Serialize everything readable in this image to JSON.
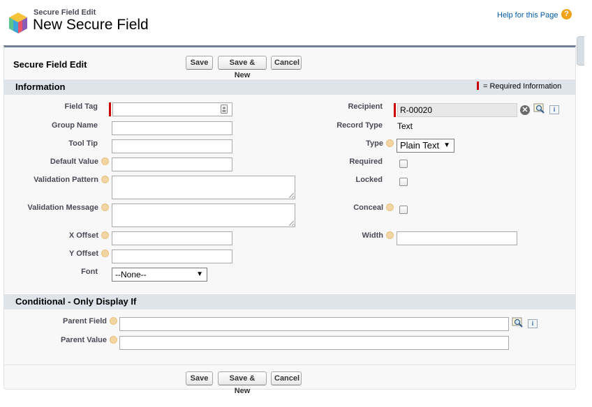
{
  "header": {
    "breadcrumb": "Secure Field Edit",
    "title": "New Secure Field",
    "help_link": "Help for this Page",
    "help_icon_glyph": "?"
  },
  "panel": {
    "title": "Secure Field Edit",
    "buttons": {
      "save": "Save",
      "save_new": "Save & New",
      "cancel": "Cancel"
    }
  },
  "information": {
    "title": "Information",
    "required_legend": "= Required Information",
    "left": {
      "field_tag": {
        "label": "Field Tag",
        "value": ""
      },
      "group_name": {
        "label": "Group Name",
        "value": ""
      },
      "tool_tip": {
        "label": "Tool Tip",
        "value": ""
      },
      "default_value": {
        "label": "Default Value",
        "value": ""
      },
      "validation_pattern": {
        "label": "Validation Pattern",
        "value": ""
      },
      "validation_message": {
        "label": "Validation Message",
        "value": ""
      },
      "x_offset": {
        "label": "X Offset",
        "value": ""
      },
      "y_offset": {
        "label": "Y Offset",
        "value": ""
      },
      "font": {
        "label": "Font",
        "selected": "--None--"
      }
    },
    "right": {
      "recipient": {
        "label": "Recipient",
        "value": "R-00020"
      },
      "record_type": {
        "label": "Record Type",
        "value": "Text"
      },
      "type": {
        "label": "Type",
        "selected": "Plain Text"
      },
      "required": {
        "label": "Required",
        "checked": false
      },
      "locked": {
        "label": "Locked",
        "checked": false
      },
      "conceal": {
        "label": "Conceal",
        "checked": false
      },
      "width": {
        "label": "Width",
        "value": ""
      }
    }
  },
  "conditional": {
    "title": "Conditional - Only Display If",
    "parent_field": {
      "label": "Parent Field",
      "value": ""
    },
    "parent_value": {
      "label": "Parent Value",
      "value": ""
    }
  },
  "glyphs": {
    "dropdown_arrow": "▼",
    "clear": "✕",
    "info": "i"
  },
  "colors": {
    "required": "#cc0000",
    "header_bar": "#747e96",
    "section_bg": "#dfe4ea",
    "link": "#015ba7",
    "help": "#f0a318"
  }
}
